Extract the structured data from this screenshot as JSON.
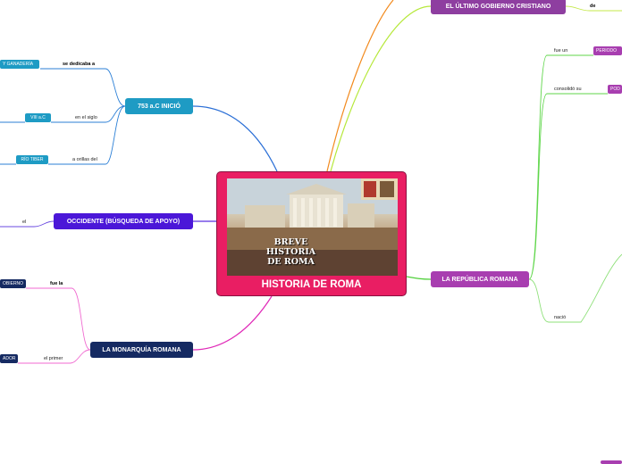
{
  "central": {
    "title": "HISTORIA DE ROMA",
    "image_caption_line1": "BREVE HISTORIA",
    "image_caption_line2": "DE  ROMA"
  },
  "left": {
    "inicio": {
      "label": "753 a.C INICIÓ",
      "color": "#1e9bc4",
      "rows": [
        {
          "link": "se dedicaba a",
          "chip": "Y GANADERÍA"
        },
        {
          "link": "en el siglo",
          "chip": "VIII a.C"
        },
        {
          "link": "a orillas del",
          "chip": "RÍO TIBER"
        }
      ]
    },
    "occidente": {
      "label": "OCCIDENTE (BÚSQUEDA DE APOYO)",
      "color": "#4b17d8",
      "link": "el"
    },
    "monarquia": {
      "label": "LA MONARQUÍA ROMANA",
      "color": "#152a62",
      "rows": [
        {
          "link": "fue la",
          "chip": "OBIERNO"
        },
        {
          "link": "el primer",
          "chip": "ADOR"
        }
      ]
    }
  },
  "right": {
    "ultimo": {
      "label": "EL ÚLTIMO GOBIERNO CRISTIANO",
      "color": "#8e3ea0",
      "link": "de"
    },
    "republica": {
      "label": "LA REPÚBLICA ROMANA",
      "color": "#a83eb0",
      "rows": [
        {
          "link": "fue un",
          "chip": "PERIODO"
        },
        {
          "link": "consolidó su",
          "chip": "POD"
        },
        {
          "link": "nació",
          "chip": ""
        }
      ]
    }
  }
}
